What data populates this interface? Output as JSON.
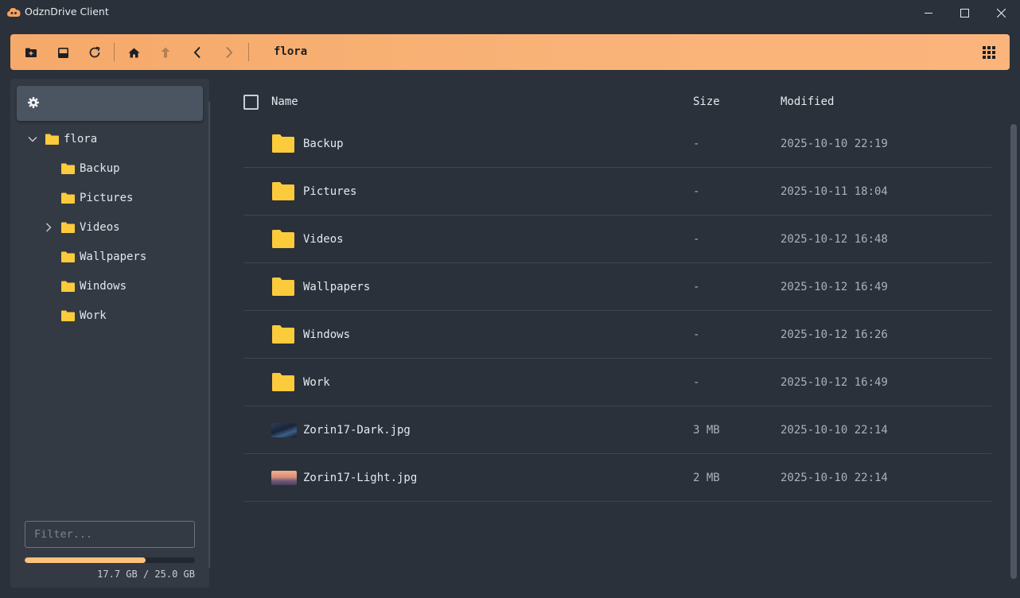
{
  "window": {
    "title": "OdznDrive Client"
  },
  "colors": {
    "accent": "#f9b378",
    "folder": "#fccb3b",
    "background": "#2a313a",
    "sidebar": "#333a44"
  },
  "toolbar": {
    "buttons": [
      {
        "name": "new-folder-icon"
      },
      {
        "name": "upload-icon"
      },
      {
        "name": "refresh-icon"
      },
      {
        "name": "home-icon"
      },
      {
        "name": "up-arrow-icon"
      },
      {
        "name": "back-icon"
      },
      {
        "name": "forward-icon"
      }
    ],
    "path": "flora",
    "view_toggle": "grid-view-icon"
  },
  "sidebar": {
    "tree": {
      "root": "flora",
      "children": [
        "Backup",
        "Pictures",
        "Videos",
        "Wallpapers",
        "Windows",
        "Work"
      ]
    },
    "filter_placeholder": "Filter...",
    "storage": {
      "used": "17.7 GB",
      "separator": "/",
      "total": "25.0 GB",
      "fraction": 0.708
    }
  },
  "table": {
    "headers": {
      "name": "Name",
      "size": "Size",
      "modified": "Modified"
    },
    "rows": [
      {
        "name": "Backup",
        "size": "-",
        "modified": "2025-10-10 22:19",
        "type": "folder"
      },
      {
        "name": "Pictures",
        "size": "-",
        "modified": "2025-10-11 18:04",
        "type": "folder"
      },
      {
        "name": "Videos",
        "size": "-",
        "modified": "2025-10-12 16:48",
        "type": "folder"
      },
      {
        "name": "Wallpapers",
        "size": "-",
        "modified": "2025-10-12 16:49",
        "type": "folder"
      },
      {
        "name": "Windows",
        "size": "-",
        "modified": "2025-10-12 16:26",
        "type": "folder"
      },
      {
        "name": "Work",
        "size": "-",
        "modified": "2025-10-12 16:49",
        "type": "folder"
      },
      {
        "name": "Zorin17-Dark.jpg",
        "size": "3 MB",
        "modified": "2025-10-10 22:14",
        "type": "image-dark"
      },
      {
        "name": "Zorin17-Light.jpg",
        "size": "2 MB",
        "modified": "2025-10-10 22:14",
        "type": "image-light"
      }
    ]
  }
}
